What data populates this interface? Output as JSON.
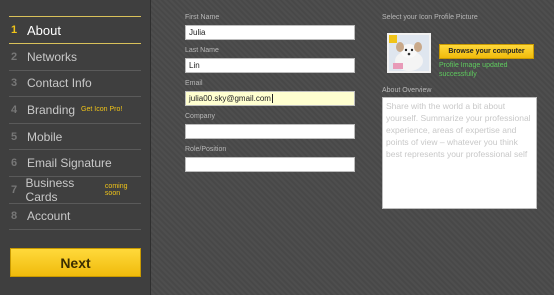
{
  "sidebar": {
    "items": [
      {
        "num": "1",
        "label": "About",
        "tag": ""
      },
      {
        "num": "2",
        "label": "Networks",
        "tag": ""
      },
      {
        "num": "3",
        "label": "Contact Info",
        "tag": ""
      },
      {
        "num": "4",
        "label": "Branding",
        "tag": "Get Icon Pro!"
      },
      {
        "num": "5",
        "label": "Mobile",
        "tag": ""
      },
      {
        "num": "6",
        "label": "Email Signature",
        "tag": ""
      },
      {
        "num": "7",
        "label": "Business Cards",
        "tag": "coming soon"
      },
      {
        "num": "8",
        "label": "Account",
        "tag": ""
      }
    ],
    "next_label": "Next"
  },
  "form": {
    "first_name": {
      "label": "First Name",
      "value": "Julia"
    },
    "last_name": {
      "label": "Last Name",
      "value": "Lin"
    },
    "email": {
      "label": "Email",
      "value": "julia00.sky@gmail.com"
    },
    "company": {
      "label": "Company",
      "value": ""
    },
    "role": {
      "label": "Role/Position",
      "value": ""
    }
  },
  "profile_picture": {
    "label": "Select your Icon Profile Picture",
    "browse_label": "Browse your computer",
    "status": "Profile Image updated successfully"
  },
  "about": {
    "label": "About Overview",
    "placeholder": "Share with the world a bit about yourself. Summarize your professional experience, areas of expertise and points of view – whatever you think best represents your professional self"
  },
  "colors": {
    "accent": "#f0c419",
    "success": "#5ecb5e",
    "background": "#4a4a4a"
  }
}
